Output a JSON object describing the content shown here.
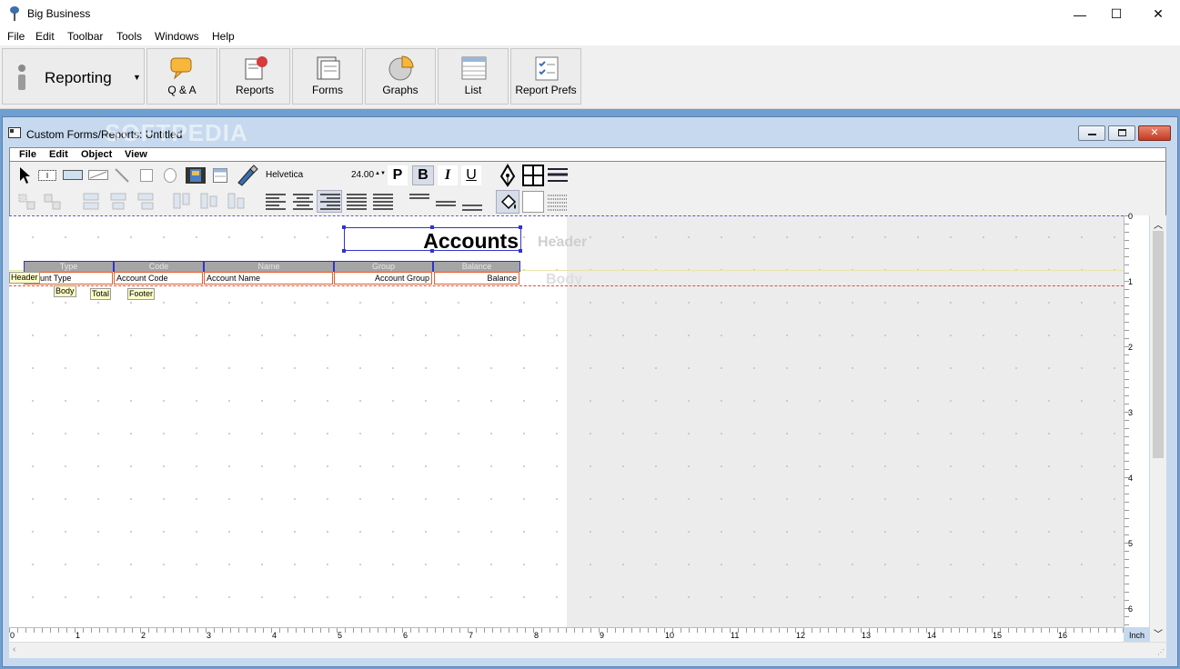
{
  "app": {
    "title": "Big Business"
  },
  "window_controls": {
    "minimize": "—",
    "maximize": "☐",
    "close": "✕"
  },
  "menu": [
    "File",
    "Edit",
    "Toolbar",
    "Tools",
    "Windows",
    "Help"
  ],
  "toolbar": {
    "mode_label": "Reporting",
    "buttons": [
      "Q & A",
      "Reports",
      "Forms",
      "Graphs",
      "List",
      "Report Prefs"
    ]
  },
  "child_window": {
    "title": "Custom Forms/Reports: Untitled",
    "watermark": "SOFTPEDIA",
    "menu": [
      "File",
      "Edit",
      "Object",
      "View"
    ],
    "font_name": "Helvetica",
    "font_size": "24.00",
    "style_buttons": [
      "P",
      "B",
      "I",
      "U"
    ]
  },
  "report": {
    "title": "Accounts",
    "section_labels": {
      "header": "Header",
      "body": "Body"
    },
    "columns": [
      {
        "header": "Type",
        "field": "ount Type"
      },
      {
        "header": "Code",
        "field": "Account Code"
      },
      {
        "header": "Name",
        "field": "Account Name"
      },
      {
        "header": "Group",
        "field": "Account Group"
      },
      {
        "header": "Balance",
        "field": "Balance"
      }
    ],
    "tags": {
      "header": "Header",
      "body": "Body",
      "total": "Total",
      "footer": "Footer"
    }
  },
  "ruler": {
    "horizontal": [
      "0",
      "1",
      "2",
      "3",
      "4",
      "5",
      "6",
      "7",
      "8",
      "9",
      "10",
      "11",
      "12",
      "13",
      "14",
      "15",
      "16"
    ],
    "vertical": [
      "0",
      "1",
      "2",
      "3",
      "4",
      "5",
      "6"
    ],
    "unit": "Inch"
  },
  "colors": {
    "mdi_background": "#6f9fd0",
    "selection": "#3333cc",
    "field_border": "#e06030"
  }
}
